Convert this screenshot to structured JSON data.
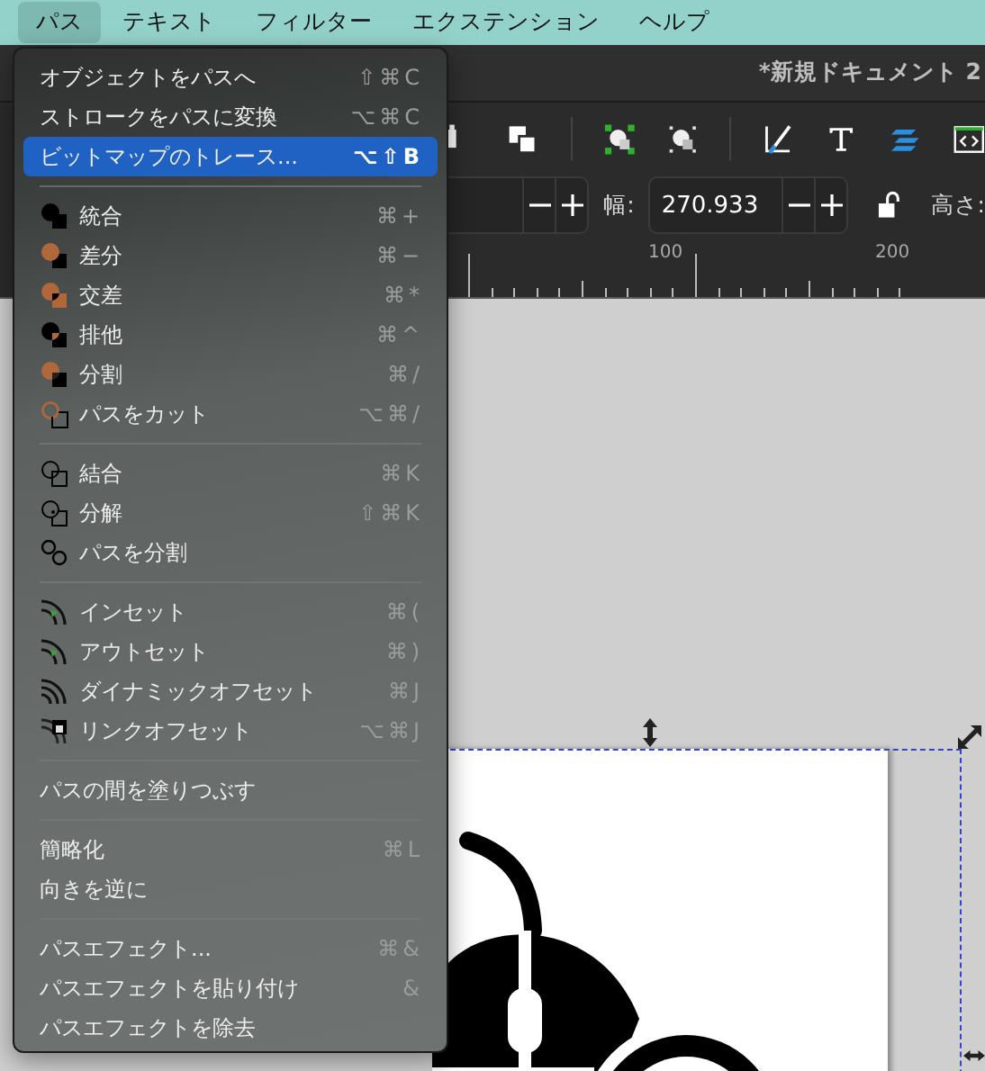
{
  "menubar": {
    "items": [
      {
        "label": "パス",
        "selected": true
      },
      {
        "label": "テキスト",
        "selected": false
      },
      {
        "label": "フィルター",
        "selected": false
      },
      {
        "label": "エクステンション",
        "selected": false
      },
      {
        "label": "ヘルプ",
        "selected": false
      }
    ]
  },
  "window": {
    "title": "*新規ドキュメント 2"
  },
  "tool_controls": {
    "width_label": "幅:",
    "width_value": "270.933",
    "height_label": "高さ:"
  },
  "ruler": {
    "labels": [
      "100",
      "200"
    ]
  },
  "menu": {
    "items": [
      {
        "kind": "item",
        "label": "オブジェクトをパスへ",
        "shortcut": "⇧⌘C",
        "selected": false
      },
      {
        "kind": "item",
        "label": "ストロークをパスに変換",
        "shortcut": "⌥⌘C",
        "selected": false
      },
      {
        "kind": "item",
        "label": "ビットマップのトレース...",
        "shortcut": "⌥⇧B",
        "selected": true
      },
      {
        "kind": "separator"
      },
      {
        "kind": "item",
        "label": "統合",
        "shortcut": "⌘+",
        "selected": false
      },
      {
        "kind": "item",
        "label": "差分",
        "shortcut": "⌘−",
        "selected": false
      },
      {
        "kind": "item",
        "label": "交差",
        "shortcut": "⌘*",
        "selected": false
      },
      {
        "kind": "item",
        "label": "排他",
        "shortcut": "⌘^",
        "selected": false
      },
      {
        "kind": "item",
        "label": "分割",
        "shortcut": "⌘/",
        "selected": false
      },
      {
        "kind": "item",
        "label": "パスをカット",
        "shortcut": "⌥⌘/",
        "selected": false
      },
      {
        "kind": "separator"
      },
      {
        "kind": "item",
        "label": "結合",
        "shortcut": "⌘K",
        "selected": false
      },
      {
        "kind": "item",
        "label": "分解",
        "shortcut": "⇧⌘K",
        "selected": false
      },
      {
        "kind": "item",
        "label": "パスを分割",
        "selected": false
      },
      {
        "kind": "separator"
      },
      {
        "kind": "item",
        "label": "インセット",
        "shortcut": "⌘(",
        "selected": false
      },
      {
        "kind": "item",
        "label": "アウトセット",
        "shortcut": "⌘)",
        "selected": false
      },
      {
        "kind": "item",
        "label": "ダイナミックオフセット",
        "shortcut": "⌘J",
        "selected": false
      },
      {
        "kind": "item",
        "label": "リンクオフセット",
        "shortcut": "⌥⌘J",
        "selected": false
      },
      {
        "kind": "separator"
      },
      {
        "kind": "item",
        "label": "パスの間を塗りつぶす",
        "selected": false
      },
      {
        "kind": "separator"
      },
      {
        "kind": "item",
        "label": "簡略化",
        "shortcut": "⌘L",
        "selected": false
      },
      {
        "kind": "item",
        "label": "向きを逆に",
        "selected": false
      },
      {
        "kind": "separator"
      },
      {
        "kind": "item",
        "label": "パスエフェクト...",
        "shortcut": "⌘&",
        "selected": false
      },
      {
        "kind": "item",
        "label": "パスエフェクトを貼り付け",
        "shortcut": "&",
        "selected": false
      },
      {
        "kind": "item",
        "label": "パスエフェクトを除去",
        "selected": false
      }
    ]
  }
}
